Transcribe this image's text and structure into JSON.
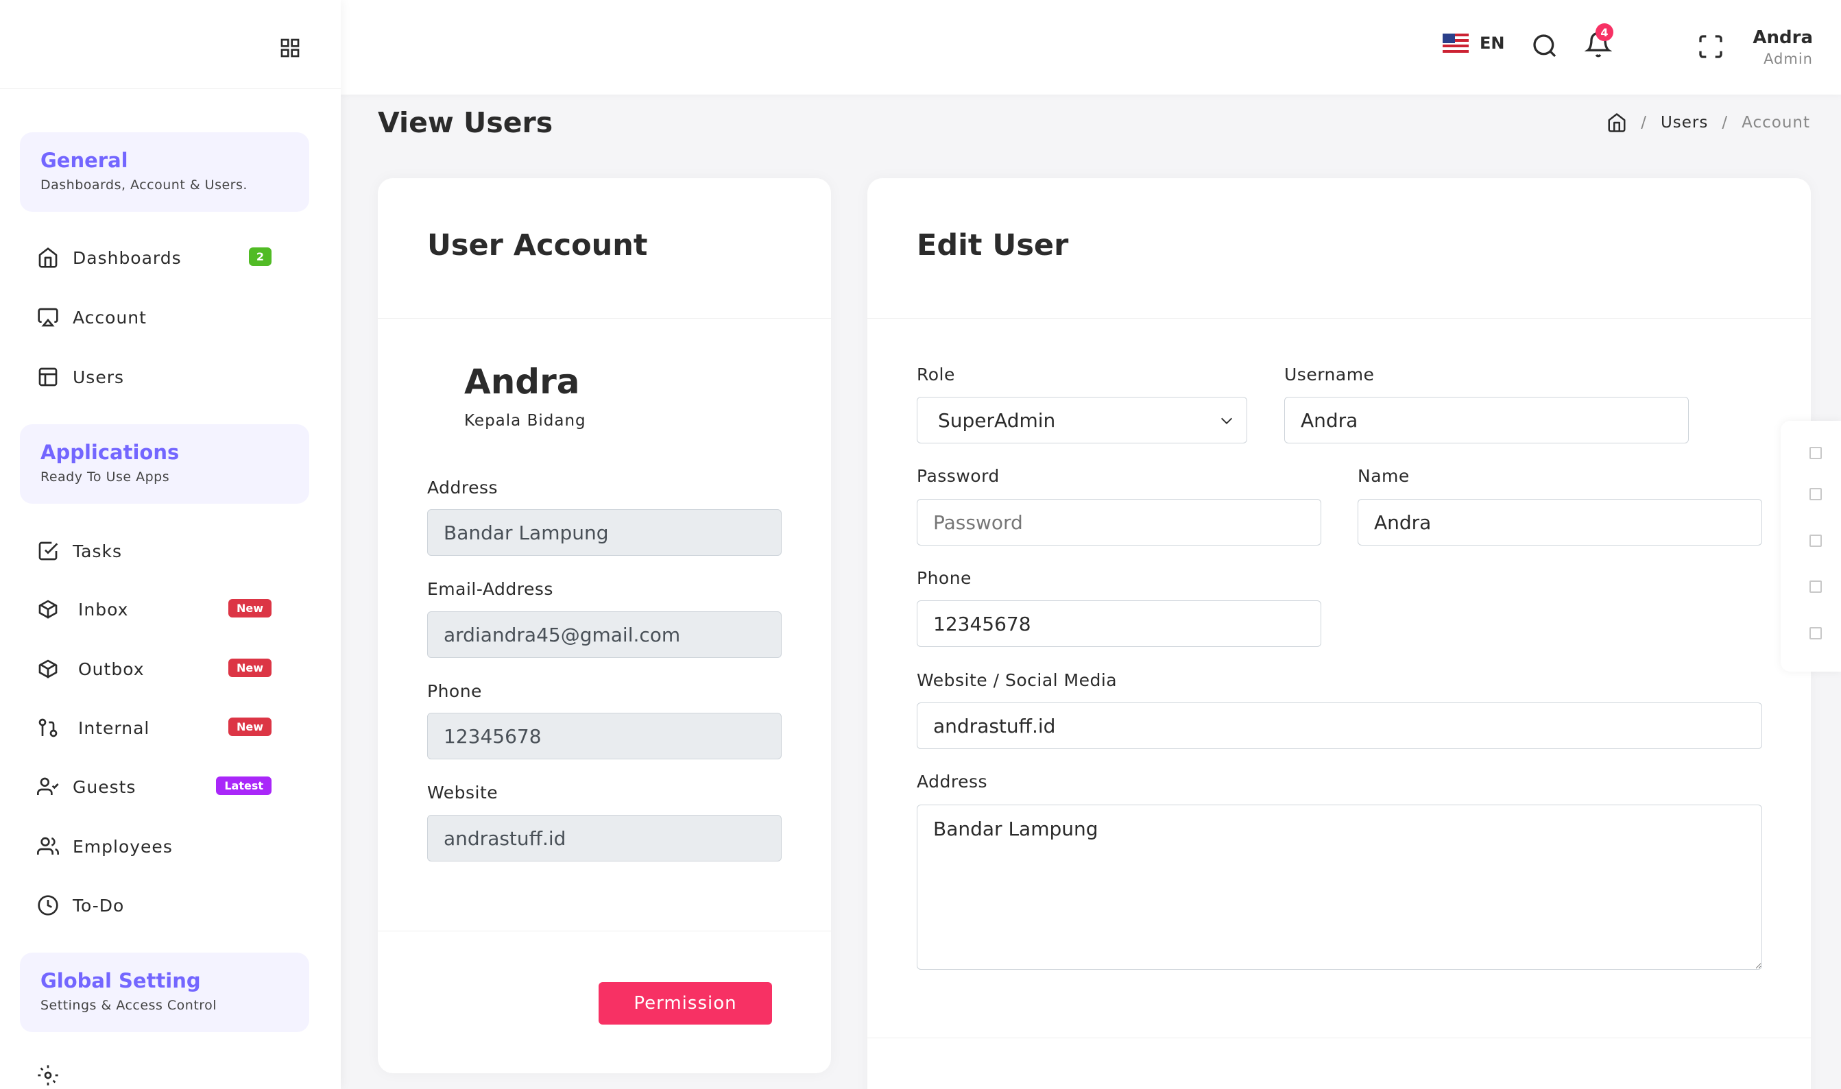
{
  "sidebar": {
    "sections": [
      {
        "title": "General",
        "subtitle": "Dashboards, Account & Users."
      },
      {
        "title": "Applications",
        "subtitle": "Ready To Use Apps"
      },
      {
        "title": "Global Setting",
        "subtitle": "Settings & Access Control"
      }
    ],
    "items": [
      {
        "label": "Dashboards",
        "badge": "2",
        "icon": "home-icon"
      },
      {
        "label": "Account",
        "icon": "monitor-icon"
      },
      {
        "label": "Users",
        "icon": "layout-icon"
      },
      {
        "label": "Tasks",
        "icon": "check-square-icon"
      },
      {
        "label": "Inbox",
        "badge": "New",
        "icon": "box-icon"
      },
      {
        "label": "Outbox",
        "badge": "New",
        "icon": "box-icon"
      },
      {
        "label": "Internal",
        "badge": "New",
        "icon": "git-pull-request-icon"
      },
      {
        "label": "Guests",
        "badge": "Latest",
        "icon": "user-check-icon"
      },
      {
        "label": "Employees",
        "icon": "users-icon"
      },
      {
        "label": "To-Do",
        "icon": "clock-icon"
      }
    ]
  },
  "header": {
    "language": "EN",
    "notification_count": "4",
    "user": {
      "name": "Andra",
      "role": "Admin"
    }
  },
  "page": {
    "title": "View Users",
    "breadcrumb": {
      "users": "Users",
      "current": "Account"
    }
  },
  "account_card": {
    "title": "User Account",
    "name": "Andra",
    "position": "Kepala Bidang",
    "fields": {
      "address": {
        "label": "Address",
        "value": "Bandar Lampung"
      },
      "email": {
        "label": "Email-Address",
        "value": "ardiandra45@gmail.com"
      },
      "phone": {
        "label": "Phone",
        "value": "12345678"
      },
      "website": {
        "label": "Website",
        "value": "andrastuff.id"
      }
    },
    "permission_button": "Permission"
  },
  "edit_card": {
    "title": "Edit User",
    "role": {
      "label": "Role",
      "value": "SuperAdmin"
    },
    "username": {
      "label": "Username",
      "value": "Andra"
    },
    "password": {
      "label": "Password",
      "placeholder": "Password"
    },
    "name": {
      "label": "Name",
      "value": "Andra"
    },
    "phone": {
      "label": "Phone",
      "value": "12345678"
    },
    "website": {
      "label": "Website / Social Media",
      "value": "andrastuff.id"
    },
    "address": {
      "label": "Address",
      "value": "Bandar Lampung"
    }
  },
  "colors": {
    "accent": "#7366ff",
    "danger": "#f73164",
    "badge_green": "#51bb25",
    "badge_red": "#dc3545",
    "badge_purple": "#a927f9"
  }
}
